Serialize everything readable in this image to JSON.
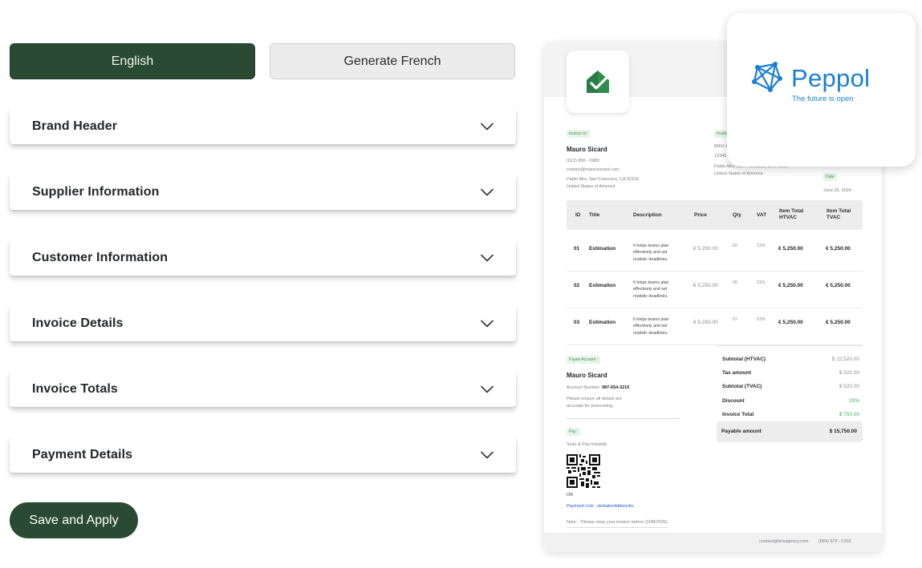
{
  "tabs": {
    "english": "English",
    "french": "Generate French"
  },
  "accordion": [
    {
      "title": "Brand Header"
    },
    {
      "title": "Supplier Information"
    },
    {
      "title": "Customer Information"
    },
    {
      "title": "Invoice Details"
    },
    {
      "title": "Invoice Totals"
    },
    {
      "title": "Payment Details"
    }
  ],
  "save_button": "Save and Apply",
  "peppol": {
    "name": "Peppol",
    "tagline": "The future is open"
  },
  "invoice": {
    "invoice_to_tag": "Invoice to:",
    "customer": {
      "name": "Mauro Sicard",
      "phone": "(612) 856 - 0989",
      "email": "contact@maurosicard.com",
      "address1": "Pablo Alto, San Francisco, CA 92102,",
      "address2": "United States of America"
    },
    "supplier_tag": "Invoice",
    "supplier": {
      "name": "BRIX Ag",
      "street": "12345 B",
      "address1": "Pablo Alto, San Francisco, CA 94108,",
      "address2": "United States of America"
    },
    "date_tag": "Date",
    "date": "June 26, 2024",
    "columns": [
      "ID",
      "Title",
      "Description",
      "Price",
      "Qty",
      "VAT",
      "Item Total HTVAC",
      "Item Total TVAC"
    ],
    "rows": [
      {
        "id": "01",
        "title": "Estimation",
        "desc1": "It helps teams plan",
        "desc2": "effectively and set",
        "desc3": "realistic deadlines.",
        "price": "€ 5,250.00",
        "qty": "02",
        "vat": "21%",
        "htvac": "€ 5,250.00",
        "tvac": "€ 5,250.00"
      },
      {
        "id": "02",
        "title": "Estimation",
        "desc1": "It helps teams plan",
        "desc2": "effectively and set",
        "desc3": "realistic deadlines.",
        "price": "€ 5,250.00",
        "qty": "05",
        "vat": "21%",
        "htvac": "€ 5,250.00",
        "tvac": "€ 5,250.00"
      },
      {
        "id": "03",
        "title": "Estimation",
        "desc1": "It helps teams plan",
        "desc2": "effectively and set",
        "desc3": "realistic deadlines.",
        "price": "€ 5,250.00",
        "qty": "07",
        "vat": "21%",
        "htvac": "€ 5,250.00",
        "tvac": "€ 5,250.00"
      }
    ],
    "payee_tag": "Payee Account :",
    "payee_name": "Mauro Sicard",
    "account_label": "Account Number:",
    "account_number": "987-654-3210",
    "payee_note1": "Please ensure all details are",
    "payee_note2": "accurate for processing.",
    "pay_tag": "Pay :",
    "scan_text": "Scan & Pay instantly",
    "or_text": "OR",
    "payment_link": "Payment Link : skcbakxvbkbsxvbv",
    "note": "Note: - Please clear your invoice before (20/8/2025)",
    "totals": [
      {
        "label": "Subtotal (HTVAC)",
        "value": "$ 15,520.00"
      },
      {
        "label": "Tax amount",
        "value": "$ 520.00"
      },
      {
        "label": "Subtotal (TVAC)",
        "value": "$ 520.00"
      },
      {
        "label": "Discount",
        "value": "20%"
      },
      {
        "label": "Invoice Total",
        "value": "$ 750.00"
      }
    ],
    "payable_label": "Payable amount",
    "payable_value": "$ 15,750.00",
    "footer_email": "contact@brixagency.com",
    "footer_phone": "(684) 879 - 0102"
  },
  "colors": {
    "brand_green": "#2a4a33",
    "peppol_blue": "#1a7fd4",
    "tag_green": "#3f8d52"
  }
}
